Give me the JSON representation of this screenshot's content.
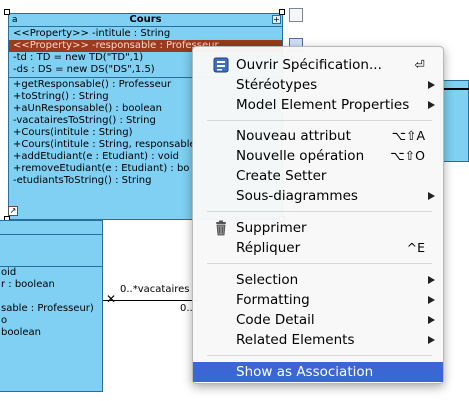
{
  "diagram": {
    "cours_class": {
      "name": "Cours",
      "stereo_tag": "a",
      "attributes": [
        "<<Property>> -intitule : String",
        "<<Property>> -responsable : Professeur",
        "-td : TD = new TD(\"TD\",1)",
        "-ds : DS = new DS(\"DS\",1.5)"
      ],
      "operations": [
        "+getResponsable() : Professeur",
        "+toString() : String",
        "+aUnResponsable() : boolean",
        "-vacatairesToString() : String",
        "+Cours(intitule : String)",
        "+Cours(intitule : String, responsable",
        "+addEtudiant(e : Etudiant) : void",
        "+removeEtudiant(e : Etudiant) : bo",
        "-etudiantsToString() : String"
      ]
    },
    "other_class": {
      "rows": [
        "oid",
        "r : boolean",
        "",
        "sable : Professeur)",
        "o",
        "boolean"
      ]
    },
    "association": {
      "role_label": "0..*vacataires",
      "mult_label": "0.."
    }
  },
  "context_menu": {
    "items": [
      {
        "label": "Ouvrir Spécification...",
        "shortcut": "⏎",
        "icon": "specification-icon"
      },
      {
        "label": "Stéréotypes",
        "submenu": true
      },
      {
        "label": "Model Element Properties",
        "submenu": true
      },
      {
        "label": "Nouveau attribut",
        "shortcut": "⌥⇧A"
      },
      {
        "label": "Nouvelle opération",
        "shortcut": "⌥⇧O"
      },
      {
        "label": "Create Setter"
      },
      {
        "label": "Sous-diagrammes",
        "submenu": true
      },
      {
        "label": "Supprimer",
        "icon": "trash-icon"
      },
      {
        "label": "Répliquer",
        "shortcut": "^E"
      },
      {
        "label": "Selection",
        "submenu": true
      },
      {
        "label": "Formatting",
        "submenu": true
      },
      {
        "label": "Code Detail",
        "submenu": true
      },
      {
        "label": "Related Elements",
        "submenu": true
      },
      {
        "label": "Show as Association",
        "highlighted": true
      }
    ]
  },
  "colors": {
    "class_fill": "#7fd0f2",
    "selected_row": "#9a3a1e",
    "menu_highlight": "#3a67d3"
  }
}
